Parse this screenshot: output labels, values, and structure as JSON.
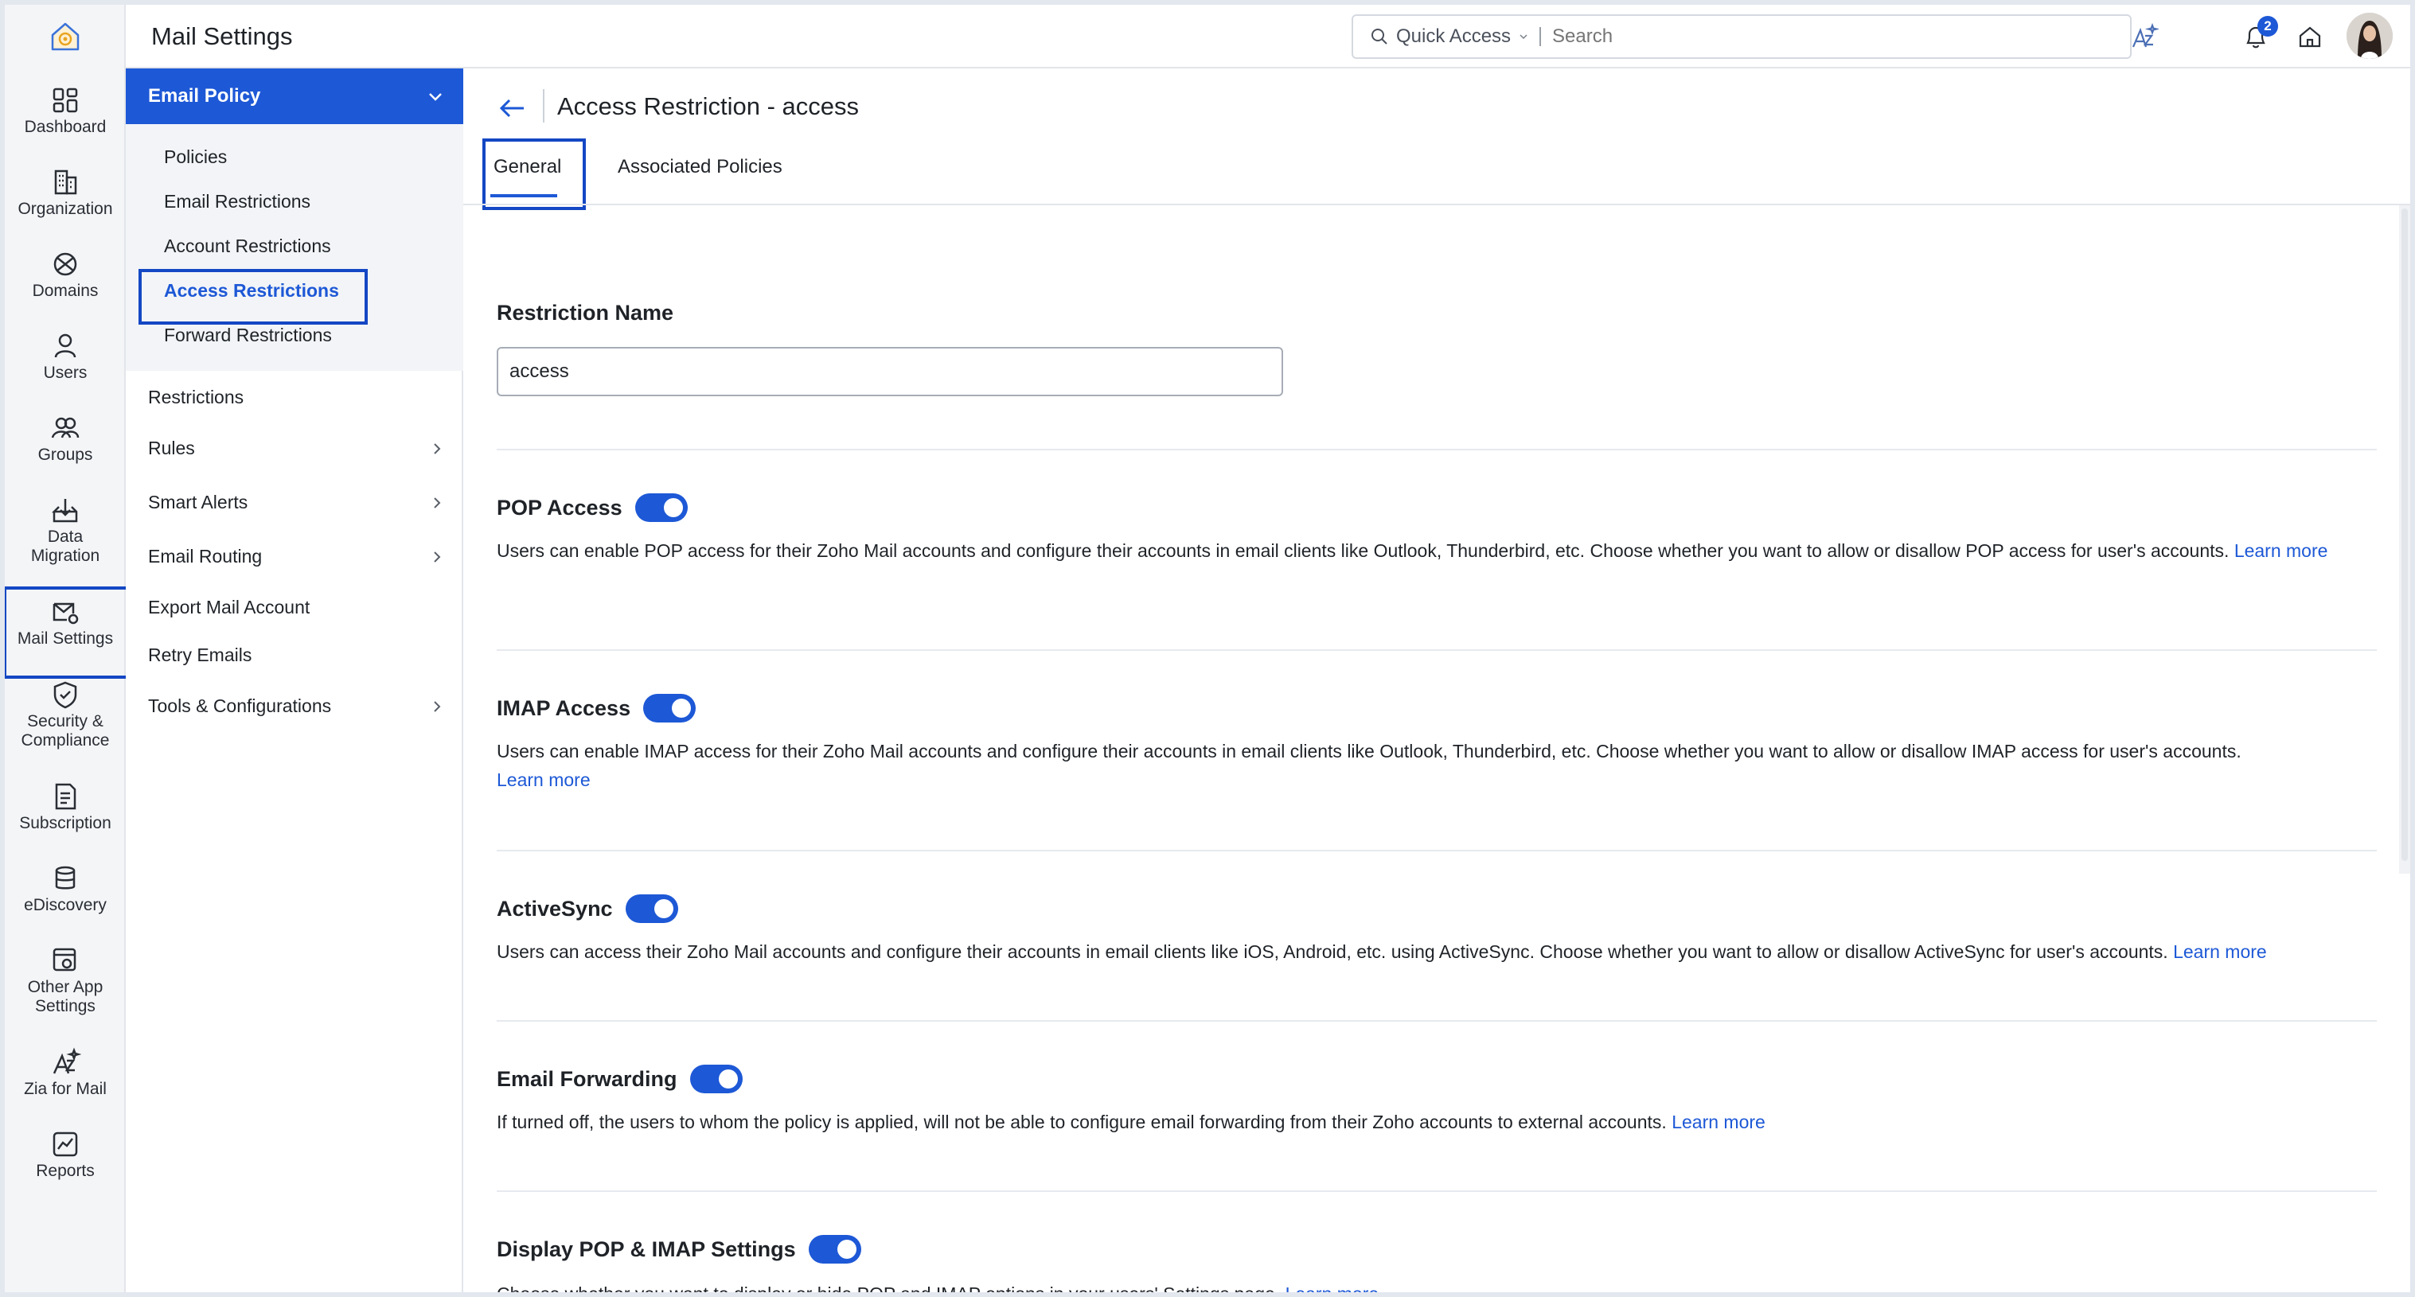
{
  "app": {
    "title": "Mail Settings"
  },
  "search": {
    "quick_access": "Quick Access",
    "placeholder": "Search"
  },
  "notifications": {
    "count": "2"
  },
  "rail": {
    "items": [
      {
        "label": "Dashboard",
        "icon": "dashboard-icon"
      },
      {
        "label": "Organization",
        "icon": "organization-icon"
      },
      {
        "label": "Domains",
        "icon": "domains-icon"
      },
      {
        "label": "Users",
        "icon": "users-icon"
      },
      {
        "label": "Groups",
        "icon": "groups-icon"
      },
      {
        "label": "Data Migration",
        "icon": "data-migration-icon"
      },
      {
        "label": "Mail Settings",
        "icon": "mail-settings-icon"
      },
      {
        "label": "Security & Compliance",
        "icon": "security-icon"
      },
      {
        "label": "Subscription",
        "icon": "subscription-icon"
      },
      {
        "label": "eDiscovery",
        "icon": "ediscovery-icon"
      },
      {
        "label": "Other App Settings",
        "icon": "other-app-settings-icon"
      },
      {
        "label": "Zia for Mail",
        "icon": "zia-icon"
      },
      {
        "label": "Reports",
        "icon": "reports-icon"
      }
    ]
  },
  "subnav": {
    "group": "Email Policy",
    "group_items": [
      "Policies",
      "Email Restrictions",
      "Account Restrictions",
      "Access Restrictions",
      "Forward Restrictions"
    ],
    "items": [
      {
        "label": "Restrictions"
      },
      {
        "label": "Rules"
      },
      {
        "label": "Smart Alerts"
      },
      {
        "label": "Email Routing"
      },
      {
        "label": "Export Mail Account"
      },
      {
        "label": "Retry Emails"
      },
      {
        "label": "Tools & Configurations"
      }
    ]
  },
  "page": {
    "title": "Access Restriction - access",
    "tabs": [
      "General",
      "Associated Policies"
    ],
    "restriction_name_label": "Restriction Name",
    "restriction_name_value": "access"
  },
  "sections": [
    {
      "title": "POP Access",
      "enabled": true,
      "desc": "Users can enable POP access for their Zoho Mail accounts and configure their accounts in email clients like Outlook, Thunderbird, etc. Choose whether you want to allow or disallow POP access for user's accounts.",
      "learn": "Learn more"
    },
    {
      "title": "IMAP Access",
      "enabled": true,
      "desc": "Users can enable IMAP access for their Zoho Mail accounts and configure their accounts in email clients like Outlook, Thunderbird, etc. Choose whether you want to allow or disallow IMAP access for user's accounts.",
      "learn": "Learn more"
    },
    {
      "title": "ActiveSync",
      "enabled": true,
      "desc": "Users can access their Zoho Mail accounts and configure their accounts in email clients like iOS, Android, etc. using ActiveSync. Choose whether you want to allow or disallow ActiveSync for user's accounts.",
      "learn": "Learn more"
    },
    {
      "title": "Email Forwarding",
      "enabled": true,
      "desc": "If turned off, the users to whom the policy is applied, will not be able to configure email forwarding from their Zoho accounts to external accounts.",
      "learn": "Learn more"
    },
    {
      "title": "Display POP & IMAP Settings",
      "enabled": true,
      "desc": "Choose whether you want to display or hide POP and IMAP options in your users' Settings page.",
      "learn": "Learn more"
    }
  ],
  "colors": {
    "accent": "#1d58d6",
    "highlight_box": "#1447c4"
  }
}
